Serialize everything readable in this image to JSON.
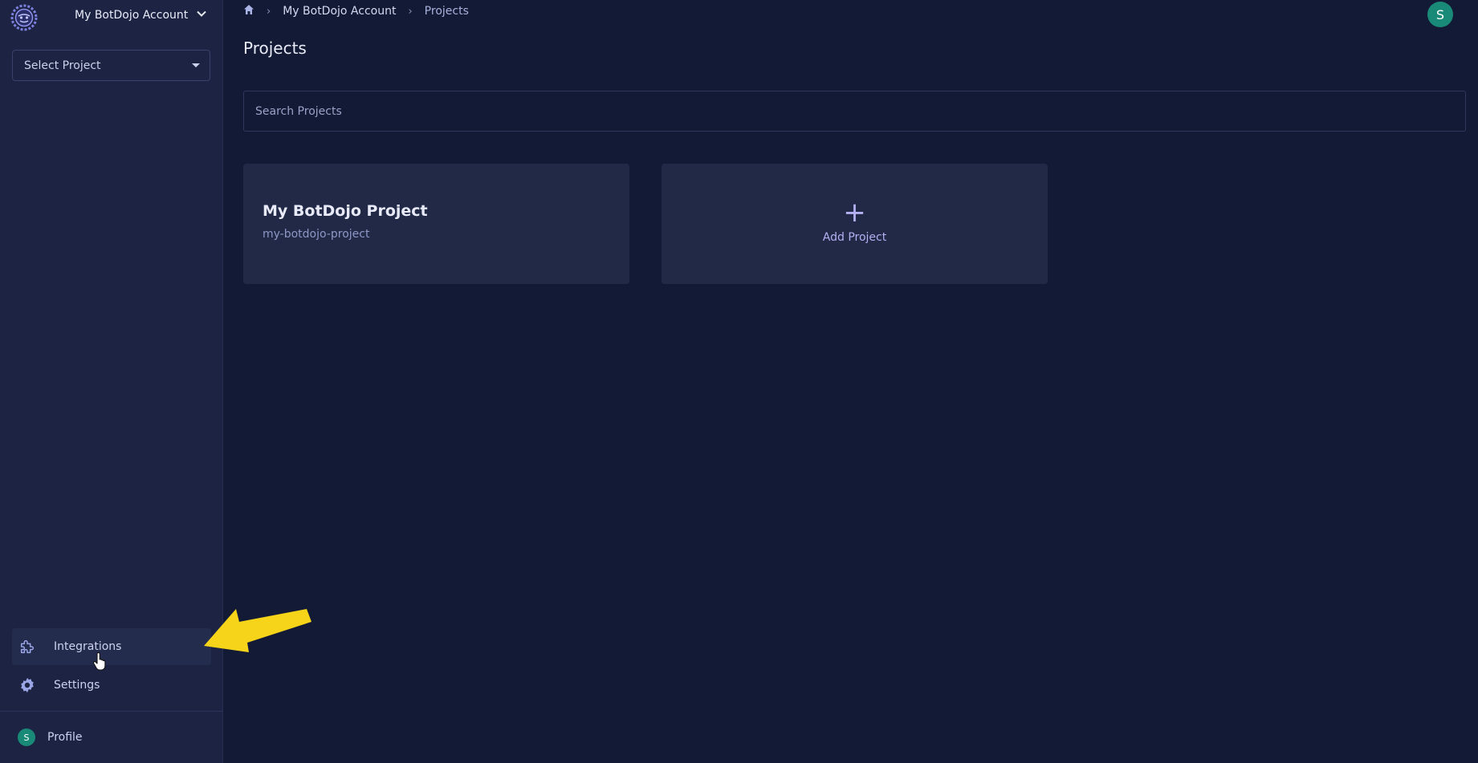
{
  "sidebar": {
    "account_name": "My BotDojo Account",
    "select_project": "Select Project",
    "nav": [
      {
        "label": "Integrations",
        "icon": "puzzle-icon"
      },
      {
        "label": "Settings",
        "icon": "gear-icon"
      }
    ],
    "profile": {
      "label": "Profile",
      "avatar_initial": "S"
    }
  },
  "header": {
    "breadcrumb": [
      "My BotDojo Account",
      "Projects"
    ],
    "avatar_initial": "S"
  },
  "main": {
    "title": "Projects",
    "search_placeholder": "Search Projects",
    "projects": [
      {
        "name": "My BotDojo Project",
        "slug": "my-botdojo-project"
      }
    ],
    "add_project_label": "Add Project"
  },
  "colors": {
    "background": "#131a35",
    "sidebar": "#1d2443",
    "card": "#212947",
    "accent": "#b4b0f2",
    "avatar": "#1a8a78",
    "annotation_arrow": "#f5d419"
  }
}
